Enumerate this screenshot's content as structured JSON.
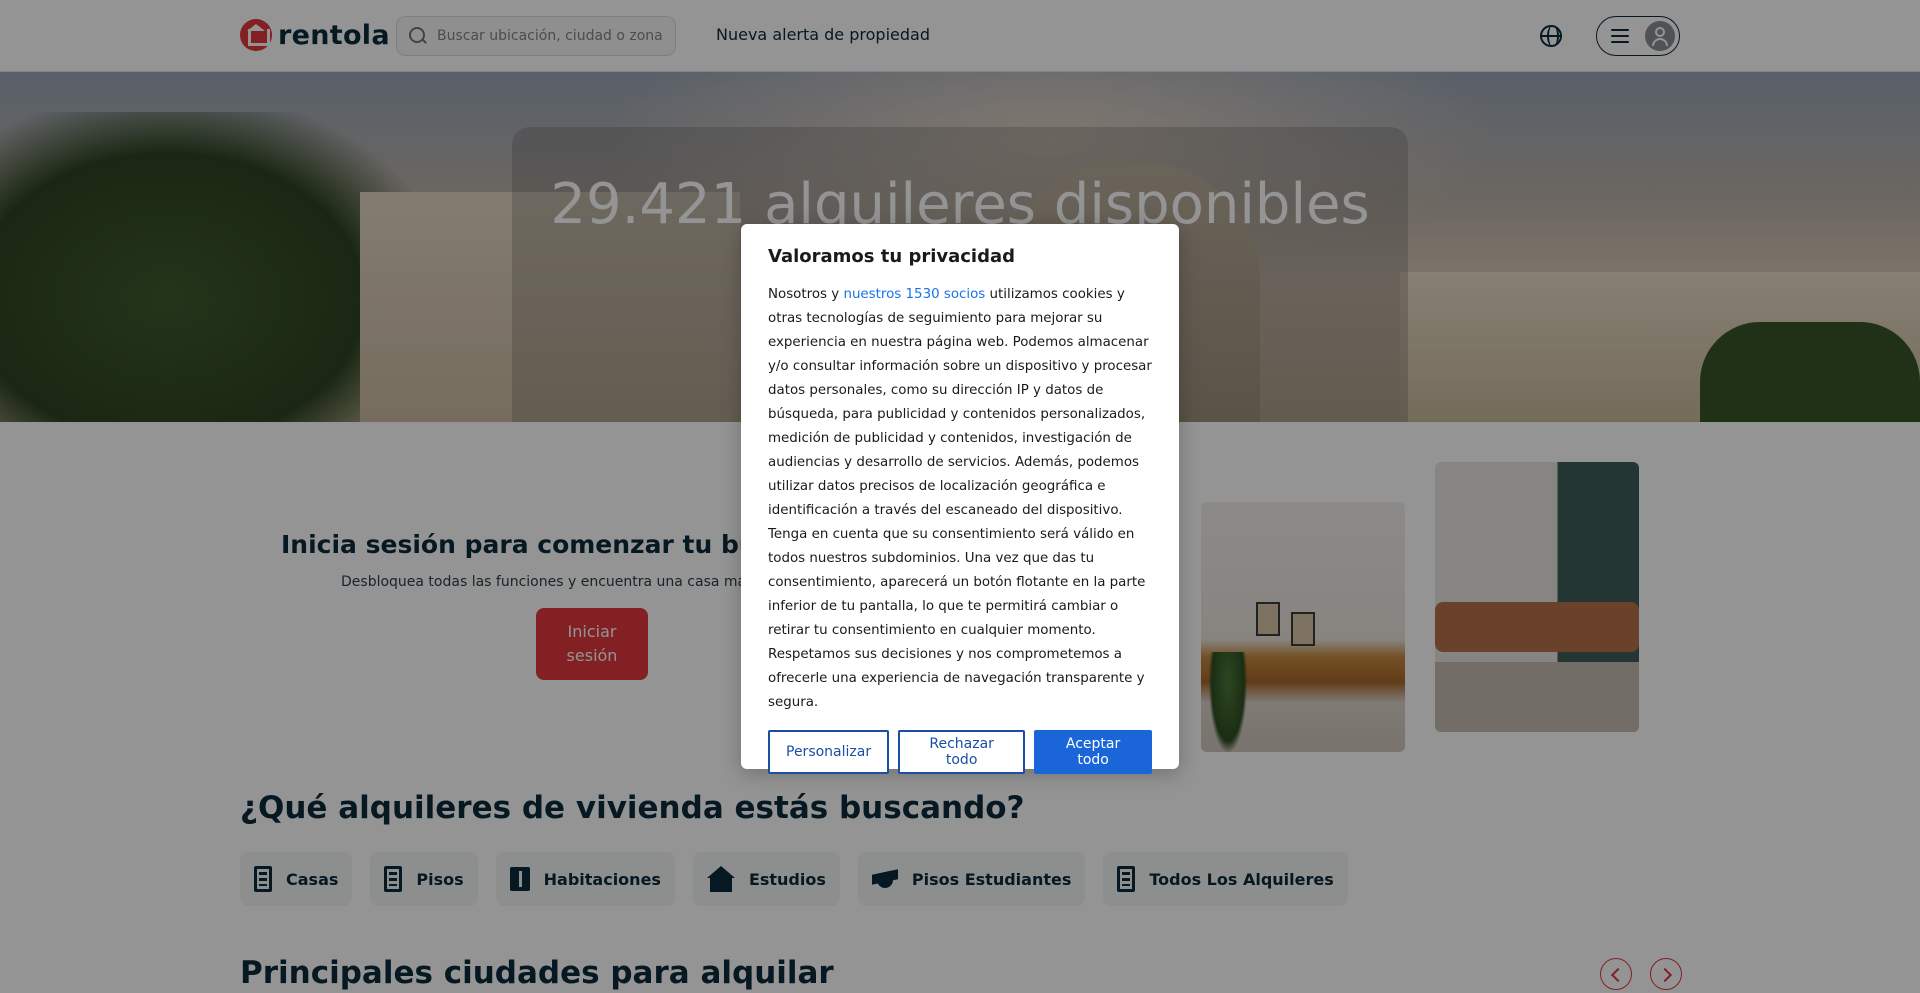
{
  "header": {
    "logo_text": "rentola",
    "search_placeholder": "Buscar ubicación, ciudad o zona",
    "nav_alert": "Nueva alerta de propiedad"
  },
  "hero": {
    "title": "29.421 alquileres disponibles"
  },
  "login": {
    "title": "Inicia sesión para comenzar tu búsqueda",
    "subtitle": "Desbloquea todas las funciones y encuentra una casa más rápido",
    "button_line1": "Iniciar",
    "button_line2": "sesión"
  },
  "categories_section": {
    "title": "¿Qué alquileres de vivienda estás buscando?",
    "items": [
      {
        "label": "Casas",
        "icon": "building-icon"
      },
      {
        "label": "Pisos",
        "icon": "apartment-icon"
      },
      {
        "label": "Habitaciones",
        "icon": "door-icon"
      },
      {
        "label": "Estudios",
        "icon": "house-icon"
      },
      {
        "label": "Pisos Estudiantes",
        "icon": "graduation-cap-icon"
      },
      {
        "label": "Todos Los Alquileres",
        "icon": "buildings-home-icon"
      }
    ]
  },
  "cities_section": {
    "title": "Principales ciudades para alquilar"
  },
  "consent": {
    "title": "Valoramos tu privacidad",
    "body_prefix": "Nosotros y ",
    "partners_link": "nuestros 1530 socios",
    "body_p1": " utilizamos cookies y otras tecnologías de seguimiento para mejorar su experiencia en nuestra página web. Podemos almacenar y/o consultar información sobre un dispositivo y procesar datos personales, como su dirección IP y datos de búsqueda, para publicidad y contenidos personalizados, medición de publicidad y contenidos, investigación de audiencias y desarrollo de servicios. Además, podemos utilizar datos precisos de localización geográfica e identificación a través del escaneado del dispositivo.",
    "body_p2": "Tenga en cuenta que su consentimiento será válido en todos nuestros subdominios. Una vez que das tu consentimiento, aparecerá un botón flotante en la parte inferior de tu pantalla, lo que te permitirá cambiar o retirar tu consentimiento en cualquier momento. Respetamos sus decisiones y nos comprometemos a ofrecerle una experiencia de navegación transparente y segura.",
    "btn_customize": "Personalizar",
    "btn_reject": "Rechazar todo",
    "btn_accept": "Aceptar todo"
  },
  "colors": {
    "brand_red": "#e0373d",
    "navy": "#0b2a3a",
    "consent_blue": "#1a66d9"
  }
}
